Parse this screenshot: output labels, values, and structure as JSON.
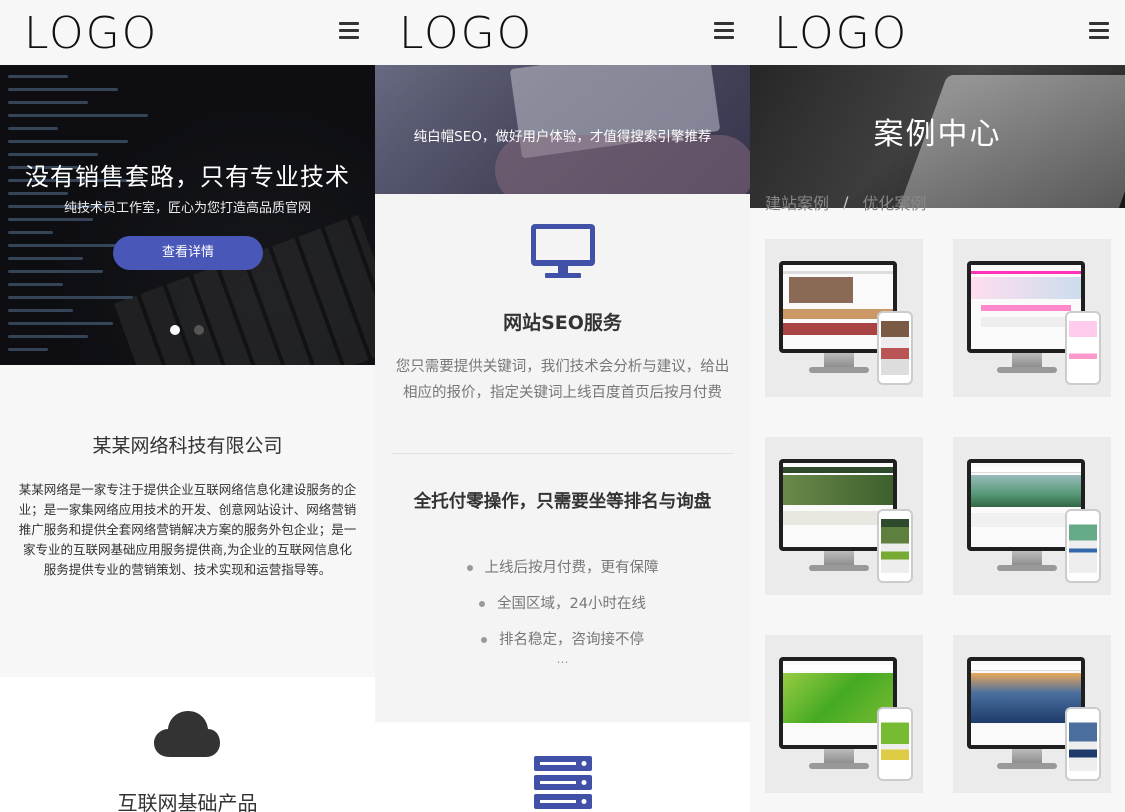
{
  "logo": "LOGO",
  "screen1": {
    "hero_title": "没有销售套路，只有专业技术",
    "hero_subtitle": "纯技术员工作室，匠心为您打造高品质官网",
    "hero_button": "查看详情",
    "company_title": "某某网络科技有限公司",
    "company_description": "某某网络是一家专注于提供企业互联网络信息化建设服务的企业；是一家集网络应用技术的开发、创意网站设计、网络营销推广服务和提供全套网络营销解决方案的服务外包企业；是一家专业的互联网基础应用服务提供商,为企业的互联网信息化服务提供专业的营销策划、技术实现和运营指导等。",
    "section_title": "互联网基础产品"
  },
  "screen2": {
    "hero_text": "纯白帽SEO，做好用户体验，才值得搜索引擎推荐",
    "service_title": "网站SEO服务",
    "service_description": "您只需要提供关键词，我们技术会分析与建议，给出相应的报价，指定关键词上线百度首页后按月付费",
    "service_subtitle": "全托付零操作，只需要坐等排名与询盘",
    "bullets": [
      "上线后按月付费，更有保障",
      "全国区域，24小时在线",
      "排名稳定，咨询接不停"
    ],
    "ellipsis": "…"
  },
  "screen3": {
    "hero_title": "案例中心",
    "tabs": [
      "建站案例",
      "优化案例"
    ],
    "tab_separator": "/"
  },
  "colors": {
    "accent": "#4857b8",
    "icon_blue": "#4151a8",
    "icon_dark": "#333333"
  }
}
